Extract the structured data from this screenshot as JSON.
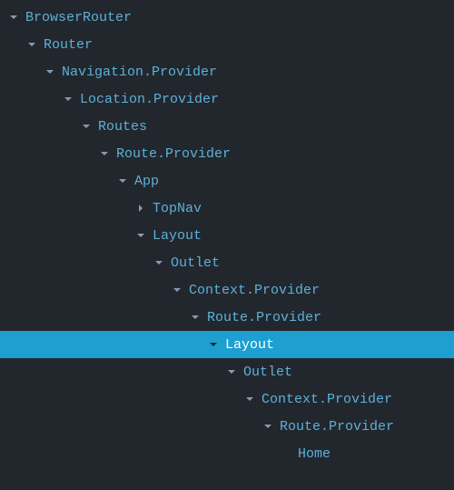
{
  "tree": [
    {
      "level": 0,
      "expanded": true,
      "label": "BrowserRouter",
      "selected": false
    },
    {
      "level": 1,
      "expanded": true,
      "label": "Router",
      "selected": false
    },
    {
      "level": 2,
      "expanded": true,
      "label": "Navigation.Provider",
      "selected": false
    },
    {
      "level": 3,
      "expanded": true,
      "label": "Location.Provider",
      "selected": false
    },
    {
      "level": 4,
      "expanded": true,
      "label": "Routes",
      "selected": false
    },
    {
      "level": 5,
      "expanded": true,
      "label": "Route.Provider",
      "selected": false
    },
    {
      "level": 6,
      "expanded": true,
      "label": "App",
      "selected": false
    },
    {
      "level": 7,
      "expanded": false,
      "label": "TopNav",
      "selected": false
    },
    {
      "level": 7,
      "expanded": true,
      "label": "Layout",
      "selected": false
    },
    {
      "level": 8,
      "expanded": true,
      "label": "Outlet",
      "selected": false
    },
    {
      "level": 9,
      "expanded": true,
      "label": "Context.Provider",
      "selected": false
    },
    {
      "level": 10,
      "expanded": true,
      "label": "Route.Provider",
      "selected": false
    },
    {
      "level": 11,
      "expanded": true,
      "label": "Layout",
      "selected": true
    },
    {
      "level": 12,
      "expanded": true,
      "label": "Outlet",
      "selected": false
    },
    {
      "level": 13,
      "expanded": true,
      "label": "Context.Provider",
      "selected": false
    },
    {
      "level": 14,
      "expanded": true,
      "label": "Route.Provider",
      "selected": false
    },
    {
      "level": 15,
      "expanded": null,
      "label": "Home",
      "selected": false
    }
  ],
  "indentPx": 20
}
